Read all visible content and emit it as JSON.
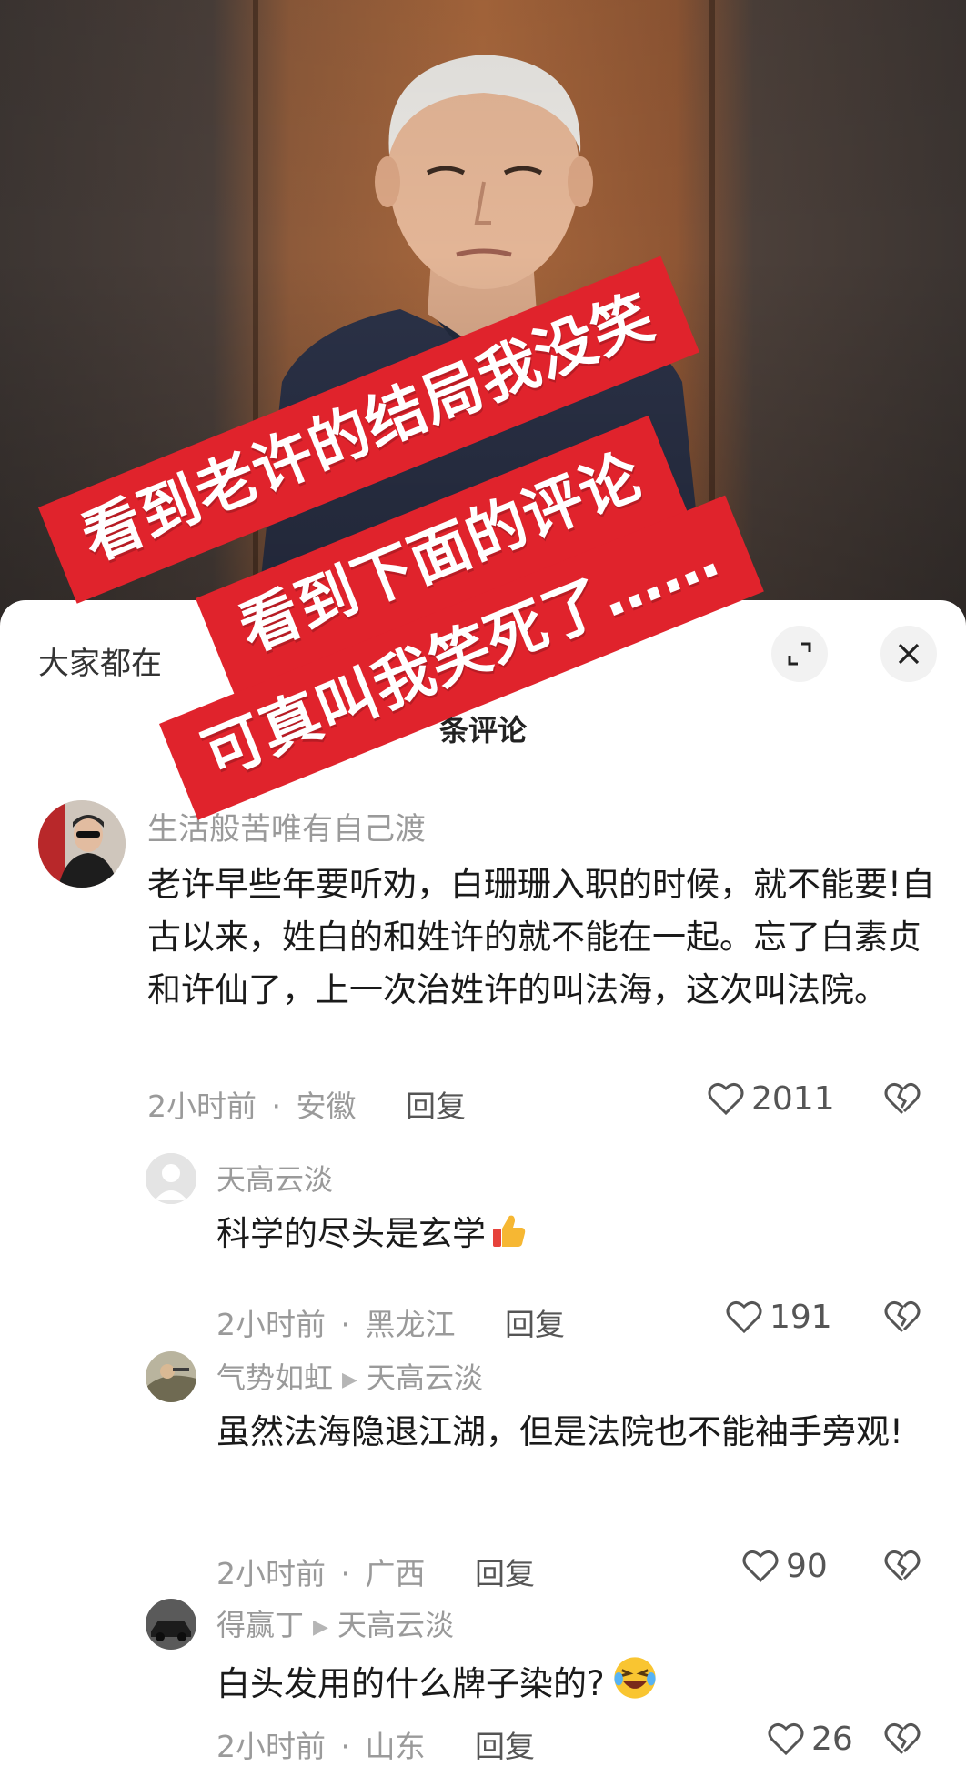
{
  "overlay": {
    "line1": "看到老许的结局我没笑",
    "line2": "看到下面的评论",
    "line3": "可真叫我笑死了……"
  },
  "sheet": {
    "header_left": "大家都在",
    "title_suffix": "条评论"
  },
  "comments": [
    {
      "user": "生活般苦唯有自己渡",
      "text": "老许早些年要听劝，白珊珊入职的时候，就不能要!自古以来，姓白的和姓许的就不能在一起。忘了白素贞和许仙了，上一次治姓许的叫法海，这次叫法院。",
      "time": "2小时前",
      "location": "安徽",
      "reply": "回复",
      "likes": "2011"
    },
    {
      "user": "天高云淡",
      "text": "科学的尽头是玄学",
      "time": "2小时前",
      "location": "黑龙江",
      "reply": "回复",
      "likes": "191"
    },
    {
      "user": "气势如虹",
      "reply_to": "天高云淡",
      "text": "虽然法海隐退江湖，但是法院也不能袖手旁观!",
      "time": "2小时前",
      "location": "广西",
      "reply": "回复",
      "likes": "90"
    },
    {
      "user": "得赢丁",
      "reply_to": "天高云淡",
      "text": "白头发用的什么牌子染的?",
      "time": "2小时前",
      "location": "山东",
      "reply": "回复",
      "likes": "26"
    }
  ],
  "colors": {
    "banner_red": "#e0232c",
    "meta_gray": "#9a9a9a",
    "text_dark": "#1a1a1a"
  },
  "icons": [
    "expand-icon",
    "close-icon",
    "heart-icon",
    "broken-heart-icon",
    "thumbs-up-emoji",
    "laughing-emoji",
    "reply-arrow-icon"
  ],
  "sep": "·"
}
